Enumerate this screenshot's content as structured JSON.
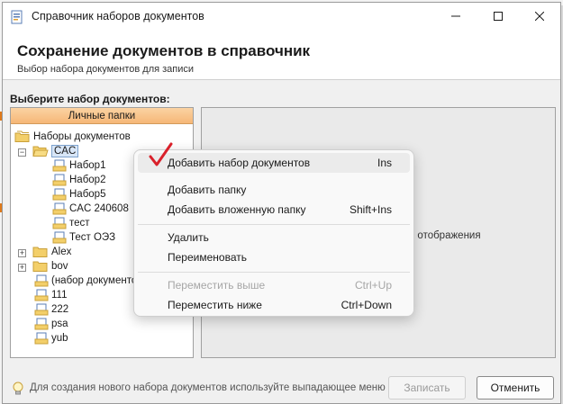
{
  "window": {
    "title": "Справочник наборов документов",
    "header_title": "Сохранение документов в справочник",
    "header_subtitle": "Выбор набора документов для записи"
  },
  "choose_label": "Выберите набор документов:",
  "tree": {
    "header": "Личные папки",
    "root": "Наборы документов",
    "items": [
      {
        "label": "CAC"
      },
      {
        "label": "Набор1"
      },
      {
        "label": "Набор2"
      },
      {
        "label": "Набор5"
      },
      {
        "label": "CAC 240608"
      },
      {
        "label": "тест"
      },
      {
        "label": "Тест ОЭЗ"
      },
      {
        "label": "Alex"
      },
      {
        "label": "bov"
      },
      {
        "label": "(набор документо"
      },
      {
        "label": "111"
      },
      {
        "label": "222"
      },
      {
        "label": "psa"
      },
      {
        "label": "yub"
      }
    ]
  },
  "right_panel_text": "я отображения",
  "footer": {
    "hint": "Для создания нового набора документов используйте выпадающее меню",
    "save_label": "Записать",
    "cancel_label": "Отменить"
  },
  "context_menu": {
    "items": [
      {
        "label": "Добавить набор документов",
        "shortcut": "Ins"
      },
      {
        "label": "Добавить папку",
        "shortcut": ""
      },
      {
        "label": "Добавить вложенную папку",
        "shortcut": "Shift+Ins"
      },
      {
        "label": "Удалить",
        "shortcut": ""
      },
      {
        "label": "Переименовать",
        "shortcut": ""
      },
      {
        "label": "Переместить выше",
        "shortcut": "Ctrl+Up"
      },
      {
        "label": "Переместить ниже",
        "shortcut": "Ctrl+Down"
      }
    ]
  },
  "colors": {
    "tree_header": "#f6b777",
    "check_mark": "#d9202a",
    "selection": "#d8e6f7"
  }
}
